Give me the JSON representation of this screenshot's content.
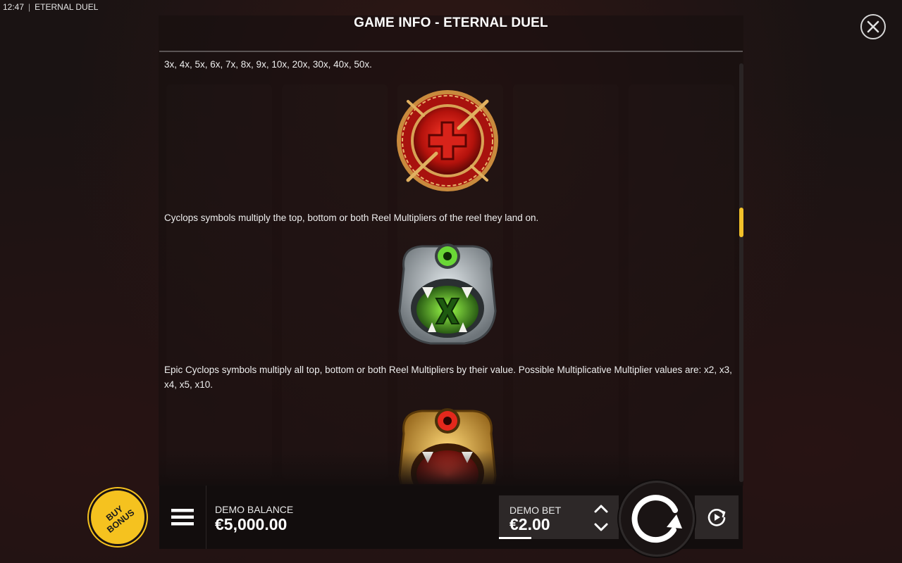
{
  "status_bar": {
    "time": "12:47",
    "app_name": "ETERNAL DUEL"
  },
  "header": {
    "title": "GAME INFO - ETERNAL DUEL"
  },
  "content": {
    "text_top": "3x, 4x, 5x, 6x, 7x, 8x, 9x, 10x, 20x, 30x, 40x, 50x.",
    "text_cyclops": "Cyclops symbols multiply the top, bottom or both Reel Multipliers of the reel they land on.",
    "text_epic_cyclops": "Epic Cyclops symbols multiply all top, bottom or both Reel Multipliers by their value. Possible Multiplicative Multiplier values are: x2, x3, x4, x5, x10.",
    "symbols": [
      "red-cross-medallion-icon",
      "silver-cyclops-icon",
      "gold-epic-cyclops-icon"
    ]
  },
  "scrollbar": {
    "position": 0.37
  },
  "bottom_bar": {
    "buy_bonus_label": "BUY BONUS",
    "balance_label": "DEMO BALANCE",
    "balance_value": "€5,000.00",
    "bet_label": "DEMO BET",
    "bet_value": "€2.00"
  },
  "colors": {
    "accent": "#f5c21f",
    "panel_bg": "#160f0f",
    "bar_bg": "#120d0d",
    "button_bg": "#2d2828"
  }
}
